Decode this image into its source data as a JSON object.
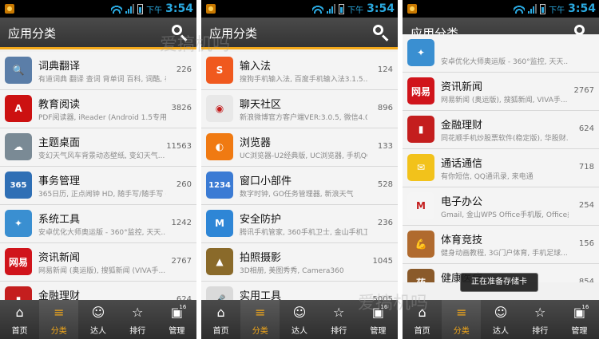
{
  "status": {
    "ampm": "下午",
    "time": "3:54"
  },
  "header": {
    "title": "应用分类"
  },
  "screens": [
    {
      "rows": [
        {
          "name": "词典翻译",
          "desc": "有道词典 翻译 查词 背单词 百科, 词酷, 谷...",
          "count": "226",
          "icon": "dictionary-icon",
          "color": "#5b7ea8",
          "glyph": "🔍"
        },
        {
          "name": "教育阅读",
          "desc": "PDF阅读器, iReader (Android 1.5专用版...",
          "count": "3826",
          "icon": "pdf-reader-icon",
          "color": "#cc1111",
          "glyph": "A"
        },
        {
          "name": "主题桌面",
          "desc": "变幻天气风车背景动态壁纸, 变幻天气...",
          "count": "11563",
          "icon": "theme-desktop-icon",
          "color": "#7a8a95",
          "glyph": "☁"
        },
        {
          "name": "事务管理",
          "desc": "365日历, 正点闹钟 HD, 随手写/随手写 (...",
          "count": "260",
          "icon": "calendar-365-icon",
          "color": "#2f6fb5",
          "glyph": "365"
        },
        {
          "name": "系统工具",
          "desc": "安卓优化大师奥运版 - 360°监控, 天天...",
          "count": "1242",
          "icon": "system-tools-icon",
          "color": "#3a8fd1",
          "glyph": "✦"
        },
        {
          "name": "资讯新闻",
          "desc": "网易新闻 (奥运版), 搜狐新闻 (VIVA手...",
          "count": "2767",
          "icon": "netease-news-icon",
          "color": "#d0141b",
          "glyph": "网易"
        },
        {
          "name": "金融理财",
          "desc": "",
          "count": "624",
          "icon": "finance-icon",
          "color": "#c41e1e",
          "glyph": "▮"
        }
      ]
    },
    {
      "rows": [
        {
          "name": "输入法",
          "desc": "搜狗手机输入法, 百度手机输入法3.1.5...",
          "count": "124",
          "icon": "sogou-input-icon",
          "color": "#f0591e",
          "glyph": "S"
        },
        {
          "name": "聊天社区",
          "desc": "新浪微博官方客户端VER:3.0.5, 微信4.0...",
          "count": "896",
          "icon": "weibo-icon",
          "color": "#e8e8e8",
          "glyph": "◉"
        },
        {
          "name": "浏览器",
          "desc": "UC浏览器-U2经典版, UC浏览器, 手机QQ...",
          "count": "133",
          "icon": "uc-browser-icon",
          "color": "#f07a12",
          "glyph": "◐"
        },
        {
          "name": "窗口小部件",
          "desc": "数字时钟, GO任务管理器, 新浪天气",
          "count": "528",
          "icon": "widget-clock-icon",
          "color": "#3b7bd4",
          "glyph": "1234"
        },
        {
          "name": "安全防护",
          "desc": "腾讯手机管家, 360手机卫士, 金山手机卫士",
          "count": "236",
          "icon": "security-shield-icon",
          "color": "#2e86d6",
          "glyph": "M"
        },
        {
          "name": "拍照摄影",
          "desc": "3D相册, 美图秀秀, Camera360",
          "count": "1045",
          "icon": "photo-camera-icon",
          "color": "#8a6a2a",
          "glyph": "▲"
        },
        {
          "name": "实用工具",
          "desc": "",
          "count": "5005",
          "icon": "microphone-icon",
          "color": "#dadada",
          "glyph": "🎤"
        }
      ]
    },
    {
      "rows": [
        {
          "name": "",
          "desc": "安卓优化大师奥运版 - 360°监控, 天天...",
          "count": "",
          "icon": "system-tools-icon",
          "color": "#3a8fd1",
          "glyph": "✦"
        },
        {
          "name": "资讯新闻",
          "desc": "网易新闻 (奥运版), 搜狐新闻, VIVA手...",
          "count": "2767",
          "icon": "netease-news-icon",
          "color": "#d0141b",
          "glyph": "网易"
        },
        {
          "name": "金融理财",
          "desc": "同花顺手机炒股票软件(稳定版), 华股财...",
          "count": "624",
          "icon": "finance-icon",
          "color": "#c41e1e",
          "glyph": "▮"
        },
        {
          "name": "通话通信",
          "desc": "有你短信, QQ通讯录, 来电通",
          "count": "718",
          "icon": "sms-envelope-icon",
          "color": "#f2c21b",
          "glyph": "✉"
        },
        {
          "name": "电子办公",
          "desc": "Gmail, 金山WPS Office手机版, Office办公...",
          "count": "254",
          "icon": "gmail-icon",
          "color": "#f5f5f5",
          "glyph": "M"
        },
        {
          "name": "体育竞技",
          "desc": "健身动画教程, 3G门户体育, 手机足球...",
          "count": "156",
          "icon": "sports-muscle-icon",
          "color": "#b06a2e",
          "glyph": "💪"
        },
        {
          "name": "健康医疗",
          "desc": "掌上药店...",
          "count": "854",
          "icon": "medicine-icon",
          "color": "#8a5a2a",
          "glyph": "药"
        }
      ]
    }
  ],
  "toast": "正在准备存储卡",
  "tabs": [
    {
      "label": "首页",
      "icon": "home-icon",
      "glyph": "⌂"
    },
    {
      "label": "分类",
      "icon": "list-icon",
      "glyph": "≡"
    },
    {
      "label": "达人",
      "icon": "face-icon",
      "glyph": "☺"
    },
    {
      "label": "排行",
      "icon": "star-icon",
      "glyph": "☆"
    },
    {
      "label": "管理",
      "icon": "manage-icon",
      "glyph": "▣",
      "badge": "16"
    }
  ],
  "active_tab": 1,
  "watermark": "爱搞机吗",
  "colors": {
    "accent": "#f4a91a",
    "status_text": "#2aa9e0",
    "bar": "#3c3c3c"
  }
}
